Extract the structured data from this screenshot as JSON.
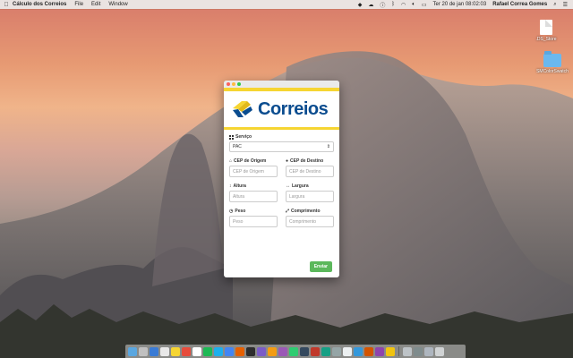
{
  "menubar": {
    "app_name": "Cálculo dos Correios",
    "menus": [
      "File",
      "Edit",
      "Window"
    ],
    "datetime": "Ter 20 de jan  08:02:03",
    "user": "Rafael Correa Gomes"
  },
  "desktop": {
    "icons": [
      {
        "label": ".DS_Store"
      },
      {
        "label": "SMColorSwatch"
      }
    ]
  },
  "window": {
    "logo_text": "Correios",
    "fields": {
      "servico": {
        "label": "Serviço",
        "value": "PAC"
      },
      "cep_origem": {
        "label": "CEP de Origem",
        "placeholder": "CEP de Origem"
      },
      "cep_destino": {
        "label": "CEP de Destino",
        "placeholder": "CEP de Destino"
      },
      "altura": {
        "label": "Altura",
        "placeholder": "Altura"
      },
      "largura": {
        "label": "Largura",
        "placeholder": "Largura"
      },
      "peso": {
        "label": "Peso",
        "placeholder": "Peso"
      },
      "comprimento": {
        "label": "Comprimento",
        "placeholder": "Comprimento"
      }
    },
    "submit_label": "Enviar"
  },
  "colors": {
    "correios_blue": "#0a4c8f",
    "correios_yellow": "#f6d532",
    "button_green": "#5cb85c"
  }
}
